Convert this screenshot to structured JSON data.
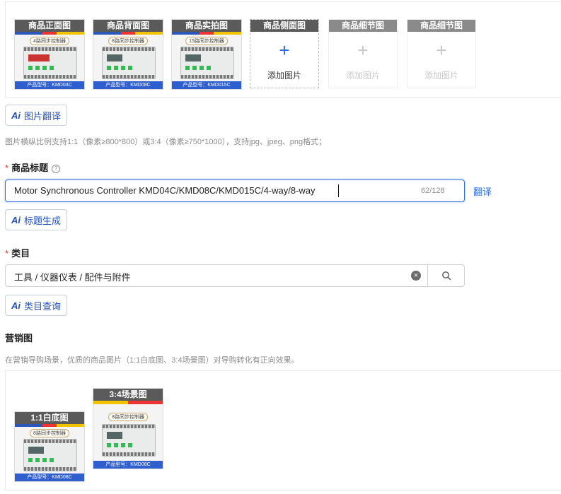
{
  "product_images": {
    "slots": [
      {
        "caption": "商品正面图",
        "tag": "4路同步控制器",
        "model": "产品型号：KMD04C"
      },
      {
        "caption": "商品背面图",
        "tag": "8路同步控制器",
        "model": "产品型号：KMD08C"
      },
      {
        "caption": "商品实拍图",
        "tag": "15路同步控制器",
        "model": "产品型号：KMD015C"
      }
    ],
    "empty_slots": [
      {
        "caption": "商品侧面图",
        "add_label": "添加图片",
        "icon": "plus-icon"
      },
      {
        "caption": "商品细节图",
        "add_label": "添加图片",
        "icon": "plus-icon"
      },
      {
        "caption": "商品细节图",
        "add_label": "添加图片",
        "icon": "plus-icon"
      }
    ],
    "translate_button": "图片翻译",
    "ai_badge": "Ai",
    "hint": "图片横纵比例支持1:1（像素≥800*800）或3:4（像素≥750*1000），支持jpg、jpeg、png格式；"
  },
  "title_field": {
    "required_mark": "*",
    "label": "商品标题",
    "help_icon": "?",
    "value": "Motor Synchronous Controller KMD04C/KMD08C/KMD015C/4-way/8-way",
    "counter": "62/128",
    "translate_link": "翻译",
    "generate_button": "标题生成"
  },
  "category_field": {
    "required_mark": "*",
    "label": "类目",
    "value": "工具 / 仪器仪表 / 配件与附件",
    "clear_icon": "×",
    "query_button": "类目查询"
  },
  "marketing": {
    "label": "营销图",
    "hint": "在营销导购场景，优质的商品图片（1:1白底图、3:4场景图）对导购转化有正向效果。",
    "images": [
      {
        "caption": "1:1白底图",
        "tag": "8路同步控制器",
        "model": "产品型号：KMD08C"
      },
      {
        "caption": "3:4场景图",
        "tag": "8路同步控制器",
        "model": "产品型号：KMD08C"
      }
    ]
  },
  "colors": {
    "accent": "#2b6de1",
    "required": "#e23b3b",
    "ai_text": "#1f4fb8"
  }
}
